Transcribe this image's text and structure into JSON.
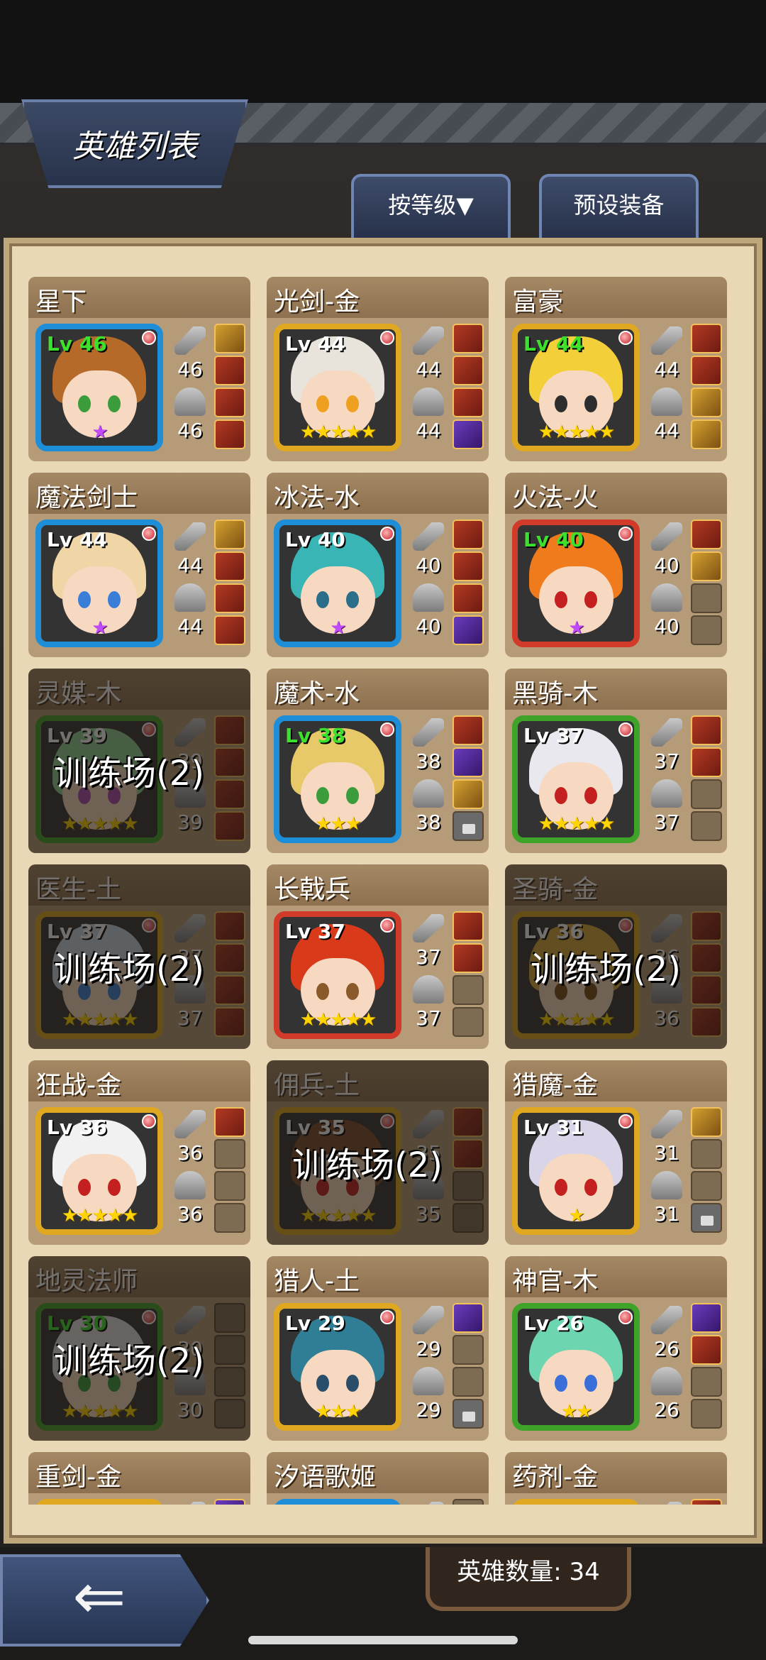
{
  "header": {
    "title": "英雄列表"
  },
  "controls": {
    "sort_label": "按等级▼",
    "preset_label": "预设装备"
  },
  "footer": {
    "hero_count_label": "英雄数量: 34"
  },
  "heroes": [
    {
      "name": "星下",
      "level": "Lv 46",
      "lv_color": "green",
      "stars": "★",
      "star_color": "purple",
      "atk": "46",
      "def": "46",
      "frame": "blue",
      "hair": "#b56a2a",
      "eyes": "#3a9c3a",
      "equip": [
        "filled gold",
        "filled",
        "filled",
        "filled"
      ],
      "dim": false
    },
    {
      "name": "光剑-金",
      "level": "Lv 44",
      "lv_color": "white",
      "stars": "★★★★★",
      "star_color": "gold",
      "atk": "44",
      "def": "44",
      "frame": "gold",
      "hair": "#e8e4dc",
      "eyes": "#f0a020",
      "equip": [
        "filled",
        "filled",
        "filled",
        "filled purple"
      ],
      "dim": false
    },
    {
      "name": "富豪",
      "level": "Lv 44",
      "lv_color": "green",
      "stars": "★★★★★",
      "star_color": "gold",
      "atk": "44",
      "def": "44",
      "frame": "gold",
      "hair": "#f3cf3a",
      "eyes": "#2d2d2d",
      "equip": [
        "filled",
        "filled",
        "filled gold",
        "filled gold"
      ],
      "dim": false
    },
    {
      "name": "魔法剑士",
      "level": "Lv 44",
      "lv_color": "white",
      "stars": "★",
      "star_color": "purple",
      "atk": "44",
      "def": "44",
      "frame": "blue",
      "hair": "#f0d5a6",
      "eyes": "#3a7ed8",
      "equip": [
        "filled gold",
        "filled",
        "filled",
        "filled"
      ],
      "dim": false
    },
    {
      "name": "冰法-水",
      "level": "Lv 40",
      "lv_color": "white",
      "stars": "★",
      "star_color": "purple",
      "atk": "40",
      "def": "40",
      "frame": "blue",
      "hair": "#39b5b5",
      "eyes": "#2a6e8a",
      "equip": [
        "filled",
        "filled",
        "filled",
        "filled purple"
      ],
      "dim": false
    },
    {
      "name": "火法-火",
      "level": "Lv 40",
      "lv_color": "green",
      "stars": "★",
      "star_color": "purple",
      "atk": "40",
      "def": "40",
      "frame": "red",
      "hair": "#f07b1c",
      "eyes": "#c42020",
      "equip": [
        "filled",
        "filled gold",
        "empty",
        "empty"
      ],
      "dim": false
    },
    {
      "name": "灵媒-木",
      "level": "Lv 39",
      "lv_color": "white",
      "stars": "★★★★★",
      "star_color": "gold",
      "atk": "39",
      "def": "39",
      "frame": "green",
      "hair": "#8ed39a",
      "eyes": "#a94ab0",
      "equip": [
        "filled",
        "filled",
        "filled",
        "filled"
      ],
      "dim": true,
      "training": "训练场(2)"
    },
    {
      "name": "魔术-水",
      "level": "Lv 38",
      "lv_color": "green",
      "stars": "★★★",
      "star_color": "gold",
      "atk": "38",
      "def": "38",
      "frame": "blue",
      "hair": "#e8c96a",
      "eyes": "#3a9c3a",
      "equip": [
        "filled",
        "filled purple",
        "filled gold",
        "locked"
      ],
      "dim": false
    },
    {
      "name": "黑骑-木",
      "level": "Lv 37",
      "lv_color": "white",
      "stars": "★★★★★",
      "star_color": "gold",
      "atk": "37",
      "def": "37",
      "frame": "green",
      "hair": "#e8e8ee",
      "eyes": "#c42020",
      "equip": [
        "filled",
        "filled",
        "empty",
        "empty"
      ],
      "dim": false
    },
    {
      "name": "医生-土",
      "level": "Lv 37",
      "lv_color": "white",
      "stars": "★★★★★",
      "star_color": "gold",
      "atk": "37",
      "def": "37",
      "frame": "gold",
      "hair": "#c7d7e6",
      "eyes": "#3a7ed8",
      "equip": [
        "filled",
        "filled",
        "filled",
        "filled"
      ],
      "dim": true,
      "training": "训练场(2)"
    },
    {
      "name": "长戟兵",
      "level": "Lv 37",
      "lv_color": "white",
      "stars": "★★★★★",
      "star_color": "gold",
      "atk": "37",
      "def": "37",
      "frame": "red",
      "hair": "#d93a1a",
      "eyes": "#8a5a2a",
      "equip": [
        "filled",
        "filled",
        "empty",
        "empty"
      ],
      "dim": false
    },
    {
      "name": "圣骑-金",
      "level": "Lv 36",
      "lv_color": "white",
      "stars": "★★★★★",
      "star_color": "gold",
      "atk": "36",
      "def": "36",
      "frame": "gold",
      "hair": "#d6a93a",
      "eyes": "#7a4a1a",
      "equip": [
        "filled",
        "filled",
        "filled",
        "filled"
      ],
      "dim": true,
      "training": "训练场(2)"
    },
    {
      "name": "狂战-金",
      "level": "Lv 36",
      "lv_color": "white",
      "stars": "★★★★★",
      "star_color": "gold",
      "atk": "36",
      "def": "36",
      "frame": "gold",
      "hair": "#f1f1f1",
      "eyes": "#c42020",
      "equip": [
        "filled",
        "empty",
        "empty",
        "empty"
      ],
      "dim": false
    },
    {
      "name": "佣兵-土",
      "level": "Lv 35",
      "lv_color": "white",
      "stars": "★★★★★",
      "star_color": "gold",
      "atk": "35",
      "def": "35",
      "frame": "gold",
      "hair": "#7a4a2a",
      "eyes": "#c42020",
      "equip": [
        "filled",
        "filled",
        "empty",
        "empty"
      ],
      "dim": true,
      "training": "训练场(2)"
    },
    {
      "name": "猎魔-金",
      "level": "Lv 31",
      "lv_color": "white",
      "stars": "★",
      "star_color": "gold",
      "atk": "31",
      "def": "31",
      "frame": "gold",
      "hair": "#d9d4e8",
      "eyes": "#c42020",
      "equip": [
        "filled gold",
        "empty",
        "empty",
        "locked"
      ],
      "dim": false
    },
    {
      "name": "地灵法师",
      "level": "Lv 30",
      "lv_color": "green",
      "stars": "★★★★★",
      "star_color": "gold",
      "atk": "30",
      "def": "30",
      "frame": "green",
      "hair": "#e0e0e0",
      "eyes": "#3a9c3a",
      "equip": [
        "empty",
        "empty",
        "empty",
        "empty"
      ],
      "dim": true,
      "training": "训练场(2)"
    },
    {
      "name": "猎人-土",
      "level": "Lv 29",
      "lv_color": "white",
      "stars": "★★★",
      "star_color": "gold",
      "atk": "29",
      "def": "29",
      "frame": "gold",
      "hair": "#2f7e96",
      "eyes": "#2a4e6a",
      "equip": [
        "filled purple",
        "empty",
        "empty",
        "locked"
      ],
      "dim": false
    },
    {
      "name": "神官-木",
      "level": "Lv 26",
      "lv_color": "white",
      "stars": "★★",
      "star_color": "gold",
      "atk": "26",
      "def": "26",
      "frame": "green",
      "hair": "#6dd6b0",
      "eyes": "#3a6ed8",
      "equip": [
        "filled purple",
        "filled",
        "empty",
        "empty"
      ],
      "dim": false
    },
    {
      "name": "重剑-金",
      "level": "",
      "lv_color": "white",
      "stars": "",
      "star_color": "gold",
      "atk": "",
      "def": "",
      "frame": "gold",
      "hair": "#999999",
      "eyes": "#333333",
      "equip": [
        "filled purple",
        "empty",
        "empty",
        "empty"
      ],
      "dim": false
    },
    {
      "name": "汐语歌姬",
      "level": "",
      "lv_color": "white",
      "stars": "",
      "star_color": "gold",
      "atk": "",
      "def": "",
      "frame": "blue",
      "hair": "#999999",
      "eyes": "#333333",
      "equip": [
        "empty",
        "empty",
        "empty",
        "empty"
      ],
      "dim": false
    },
    {
      "name": "药剂-金",
      "level": "",
      "lv_color": "white",
      "stars": "",
      "star_color": "gold",
      "atk": "",
      "def": "",
      "frame": "gold",
      "hair": "#999999",
      "eyes": "#333333",
      "equip": [
        "filled",
        "empty",
        "empty",
        "empty"
      ],
      "dim": false
    }
  ]
}
